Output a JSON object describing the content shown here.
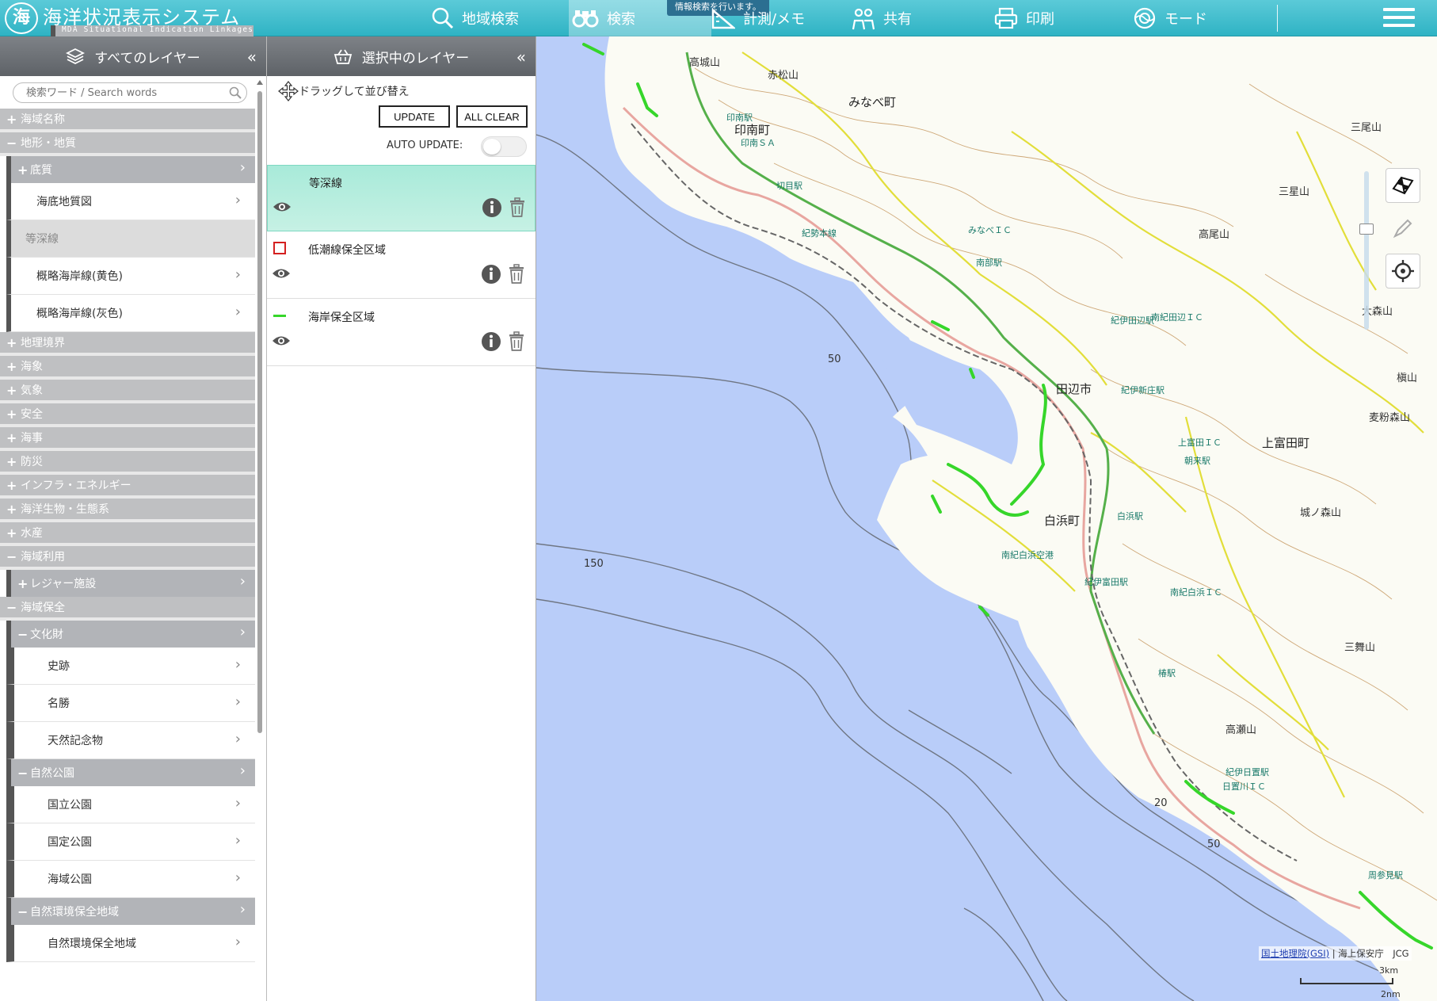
{
  "app": {
    "logo_mark": "海",
    "title": "海洋状況表示システム",
    "subtitle": "MDA Situational Indication Linkages"
  },
  "nav": {
    "items": [
      {
        "label": "地域検索",
        "icon": "search-icon"
      },
      {
        "label": "検索",
        "icon": "binoculars-icon",
        "active": true
      },
      {
        "label": "計測/メモ",
        "icon": "ruler-icon"
      },
      {
        "label": "共有",
        "icon": "people-icon"
      },
      {
        "label": "印刷",
        "icon": "printer-icon"
      },
      {
        "label": "モード",
        "icon": "mode-icon"
      }
    ],
    "tooltip": "情報検索を行います。",
    "menu_icon": "hamburger-icon"
  },
  "all_layers": {
    "title": "すべてのレイヤー",
    "collapse": "«",
    "search_placeholder": "検索ワード / Search words",
    "tree": [
      {
        "kind": "cat",
        "sym": "+",
        "label": "海域名称"
      },
      {
        "kind": "cat",
        "sym": "−",
        "label": "地形・地質"
      },
      {
        "kind": "sub",
        "sym": "+",
        "label": "底質"
      },
      {
        "kind": "leaf",
        "label": "海底地質図"
      },
      {
        "kind": "leaf-disabled",
        "label": "等深線"
      },
      {
        "kind": "leaf",
        "label": "概略海岸線(黄色)"
      },
      {
        "kind": "leaf",
        "label": "概略海岸線(灰色)"
      },
      {
        "kind": "cat",
        "sym": "+",
        "label": "地理境界"
      },
      {
        "kind": "cat",
        "sym": "+",
        "label": "海象"
      },
      {
        "kind": "cat",
        "sym": "+",
        "label": "気象"
      },
      {
        "kind": "cat",
        "sym": "+",
        "label": "安全"
      },
      {
        "kind": "cat",
        "sym": "+",
        "label": "海事"
      },
      {
        "kind": "cat",
        "sym": "+",
        "label": "防災"
      },
      {
        "kind": "cat",
        "sym": "+",
        "label": "インフラ・エネルギー"
      },
      {
        "kind": "cat",
        "sym": "+",
        "label": "海洋生物・生態系"
      },
      {
        "kind": "cat",
        "sym": "+",
        "label": "水産"
      },
      {
        "kind": "cat",
        "sym": "−",
        "label": "海域利用"
      },
      {
        "kind": "sub",
        "sym": "+",
        "label": "レジャー施設"
      },
      {
        "kind": "cat",
        "sym": "−",
        "label": "海域保全"
      },
      {
        "kind": "sub",
        "sym": "−",
        "label": "文化財"
      },
      {
        "kind": "deep",
        "label": "史跡"
      },
      {
        "kind": "deep",
        "label": "名勝"
      },
      {
        "kind": "deep",
        "label": "天然記念物"
      },
      {
        "kind": "sub",
        "sym": "−",
        "label": "自然公園"
      },
      {
        "kind": "deep",
        "label": "国立公園"
      },
      {
        "kind": "deep",
        "label": "国定公園"
      },
      {
        "kind": "deep",
        "label": "海域公園"
      },
      {
        "kind": "sub",
        "sym": "−",
        "label": "自然環境保全地域"
      },
      {
        "kind": "deep",
        "label": "自然環境保全地域"
      }
    ]
  },
  "selected_layers": {
    "title": "選択中のレイヤー",
    "collapse": "«",
    "drag_hint": "ドラッグして並び替え",
    "update_label": "UPDATE",
    "clear_label": "ALL CLEAR",
    "auto_update_label": "AUTO UPDATE:",
    "auto_update_on": false,
    "layers": [
      {
        "name": "等深線",
        "legend": "none",
        "active": true
      },
      {
        "name": "低潮線保全区域",
        "legend": "red-square"
      },
      {
        "name": "海岸保全区域",
        "legend": "green-line"
      }
    ]
  },
  "map": {
    "labels": [
      {
        "text": "印南町",
        "cls": "big"
      },
      {
        "text": "みなべ町",
        "cls": "big"
      },
      {
        "text": "田辺市",
        "cls": "big"
      },
      {
        "text": "上富田町",
        "cls": "big"
      },
      {
        "text": "白浜町",
        "cls": "big"
      },
      {
        "text": "高城山",
        "cls": ""
      },
      {
        "text": "赤松山",
        "cls": ""
      },
      {
        "text": "三星山",
        "cls": ""
      },
      {
        "text": "高尾山",
        "cls": ""
      },
      {
        "text": "三尾山",
        "cls": ""
      },
      {
        "text": "大森山",
        "cls": ""
      },
      {
        "text": "槇山",
        "cls": ""
      },
      {
        "text": "麦粉森山",
        "cls": ""
      },
      {
        "text": "城ノ森山",
        "cls": ""
      },
      {
        "text": "三舞山",
        "cls": ""
      },
      {
        "text": "高瀬山",
        "cls": ""
      },
      {
        "text": "印南駅",
        "cls": "st"
      },
      {
        "text": "切目駅",
        "cls": "st"
      },
      {
        "text": "南部駅",
        "cls": "st"
      },
      {
        "text": "紀伊田辺駅",
        "cls": "st"
      },
      {
        "text": "紀伊新庄駅",
        "cls": "st"
      },
      {
        "text": "朝来駅",
        "cls": "st"
      },
      {
        "text": "白浜駅",
        "cls": "st"
      },
      {
        "text": "紀伊富田駅",
        "cls": "st"
      },
      {
        "text": "椿駅",
        "cls": "st"
      },
      {
        "text": "紀伊日置駅",
        "cls": "st"
      },
      {
        "text": "周参見駅",
        "cls": "st"
      },
      {
        "text": "南紀白浜空港",
        "cls": "st"
      },
      {
        "text": "紀勢本線",
        "cls": "st"
      },
      {
        "text": "南紀白浜ＩＣ",
        "cls": "st"
      },
      {
        "text": "上富田ＩＣ",
        "cls": "st"
      },
      {
        "text": "南紀田辺ＩＣ",
        "cls": "st"
      },
      {
        "text": "みなべＩＣ",
        "cls": "st"
      },
      {
        "text": "日置川ＩＣ",
        "cls": "st"
      },
      {
        "text": "印南ＳＡ",
        "cls": "st"
      },
      {
        "text": "150",
        "cls": ""
      },
      {
        "text": "50",
        "cls": ""
      },
      {
        "text": "20",
        "cls": ""
      },
      {
        "text": "50",
        "cls": ""
      }
    ],
    "attribution_link": "国土地理院(GSI)",
    "attribution_rest": " | 海上保安庁　JCG",
    "scale_km": "3km",
    "scale_nm": "2nm"
  },
  "colors": {
    "nav_bg": "#2fb3c4",
    "panel_header": "#6b6f74",
    "sea": "#b9cdf9",
    "land": "#fdfdf8",
    "active_layer": "#b4eddc",
    "coast_green": "#36d62a"
  }
}
